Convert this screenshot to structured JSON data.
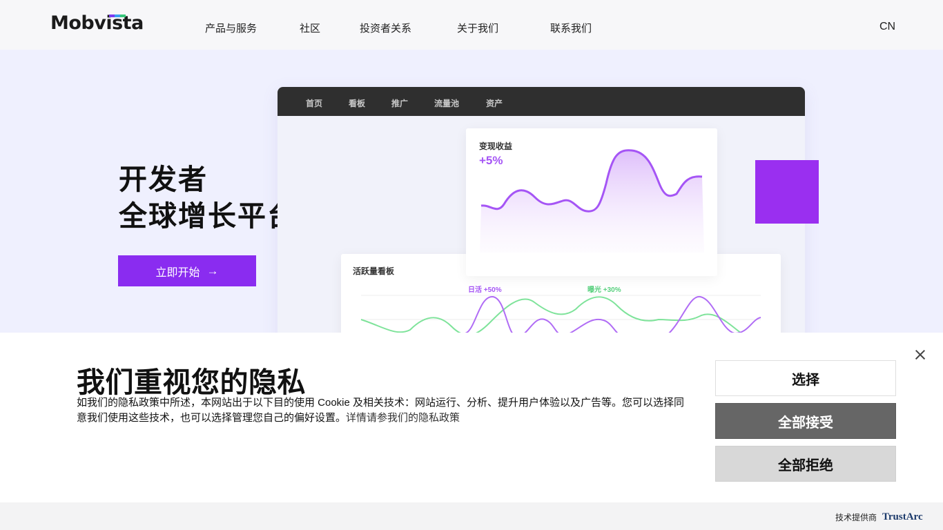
{
  "header": {
    "logo": "Mobvista",
    "nav": [
      "产品与服务",
      "社区",
      "投资者关系",
      "关于我们",
      "联系我们"
    ],
    "lang": "CN"
  },
  "hero": {
    "title_line1": "开发者",
    "title_line2": "全球增长平台",
    "cta_label": "立即开始"
  },
  "dashboard": {
    "tabs": [
      "首页",
      "看板",
      "推广",
      "流量池",
      "资产"
    ],
    "revenue_card": {
      "title": "变现收益",
      "value": "+5%"
    },
    "activity_card": {
      "title": "活跃量看板",
      "legend_purple": "日活 +50%",
      "legend_green": "曝光 +30%"
    }
  },
  "privacy": {
    "title": "我们重视您的隐私",
    "description": "如我们的隐私政策中所述，本网站出于以下目的使用 Cookie 及相关技术：网站运行、分析、提升用户体验以及广告等。您可以选择同意我们使用这些技术，也可以选择管理您自己的偏好设置。",
    "link_text": "详情请参我们的隐私政策",
    "choose_label": "选择",
    "accept_label": "全部接受",
    "reject_label": "全部拒绝"
  },
  "footer": {
    "powered_by": "技术提供商",
    "brand": "TrustArc"
  },
  "colors": {
    "accent": "#8a2cf0",
    "chart_purple": "#a555f5",
    "chart_green": "#58d07e",
    "accept_bg": "#666666",
    "reject_bg": "#d8d8d8"
  },
  "icons": {
    "cta_arrow": "arrow-right-icon",
    "close": "close-icon"
  }
}
